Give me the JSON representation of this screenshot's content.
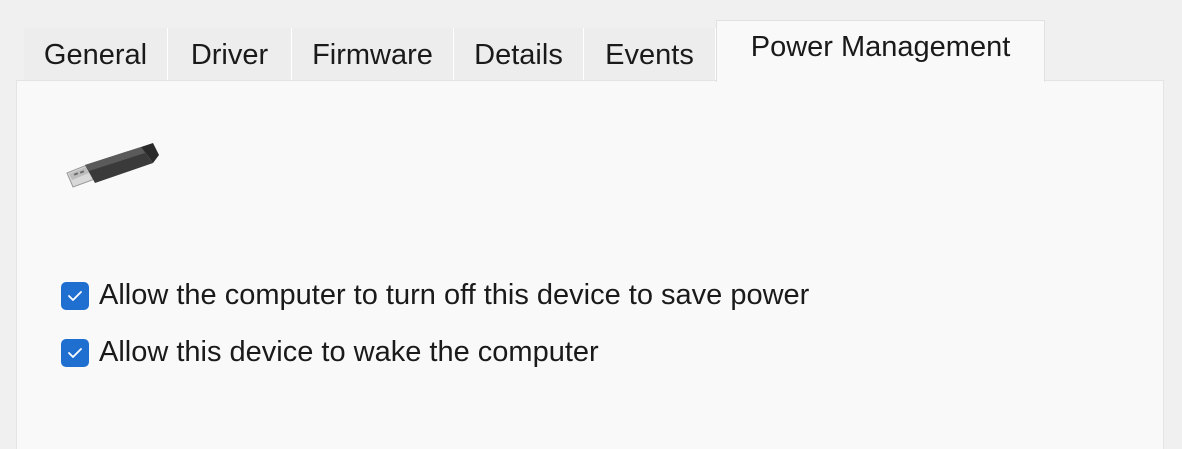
{
  "tabs": [
    {
      "label": "General",
      "active": false
    },
    {
      "label": "Driver",
      "active": false
    },
    {
      "label": "Firmware",
      "active": false
    },
    {
      "label": "Details",
      "active": false
    },
    {
      "label": "Events",
      "active": false
    },
    {
      "label": "Power Management",
      "active": true
    }
  ],
  "device_icon": "usb-connector-icon",
  "options": [
    {
      "label": "Allow the computer to turn off this device to save power",
      "checked": true
    },
    {
      "label": "Allow this device to wake the computer",
      "checked": true
    }
  ],
  "colors": {
    "accent": "#1f6fd1",
    "panel_background": "#f9f9f9",
    "window_background": "#f0f0f0"
  }
}
